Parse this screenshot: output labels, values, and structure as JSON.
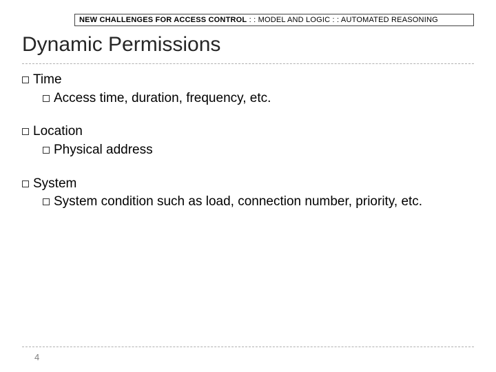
{
  "header": {
    "bold_lead": "NEW CHALLENGES FOR ACCESS CONTROL",
    "rest": " : : MODEL AND LOGIC : : AUTOMATED REASONING"
  },
  "title": "Dynamic Permissions",
  "bullets": {
    "time": {
      "label": "Time",
      "sub": "Access time, duration, frequency, etc."
    },
    "location": {
      "label": "Location",
      "sub": "Physical address"
    },
    "system": {
      "label": "System",
      "sub": "System condition such as load, connection number, priority, etc."
    }
  },
  "page_number": "4"
}
